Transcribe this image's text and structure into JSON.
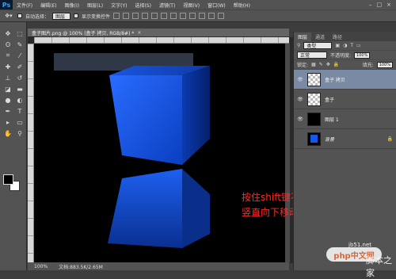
{
  "app": {
    "logo": "Ps"
  },
  "menu": [
    "文件(F)",
    "编辑(E)",
    "图像(I)",
    "图层(L)",
    "文字(Y)",
    "选择(S)",
    "滤镜(T)",
    "视图(V)",
    "窗口(W)",
    "帮助(H)"
  ],
  "window_controls": [
    "–",
    "□",
    "×"
  ],
  "options": {
    "auto_select_label": "自动选择：",
    "auto_select_value": "图层",
    "show_transform_label": "显示变换控件"
  },
  "document": {
    "tab_title": "盒子图片.png @ 100% (盒子 拷贝, RGB/8#) *",
    "zoom": "100%",
    "doc_size": "文档:883.5K/2.65M"
  },
  "annotation": {
    "line1_prefix": "按住",
    "line1_key": "shift",
    "line1_suffix": "键不放，",
    "line2": "竖直向下移动到合适的位置"
  },
  "layers_panel": {
    "tabs": [
      "图层",
      "通道",
      "路径"
    ],
    "filter_label": "类型",
    "blend_mode": "正常",
    "opacity_label": "不透明度:",
    "opacity_value": "100%",
    "lock_label": "锁定:",
    "fill_label": "填充:",
    "fill_value": "100%",
    "layers": [
      {
        "name": "盒子 拷贝",
        "thumb": "checker",
        "visible": true,
        "selected": true
      },
      {
        "name": "盒子",
        "thumb": "checker",
        "visible": true,
        "selected": false
      },
      {
        "name": "图层 1",
        "thumb": "black",
        "visible": true,
        "selected": false
      },
      {
        "name": "背景",
        "thumb": "blue",
        "visible": false,
        "selected": false
      }
    ]
  },
  "watermark": {
    "site": "jb51.net",
    "php_logo": "php中文网",
    "script_home": "脚本之家"
  },
  "colors": {
    "box_blue": "#1557e8",
    "annotation_red": "#ff2a2a",
    "selected_layer": "#7a8aa4"
  }
}
